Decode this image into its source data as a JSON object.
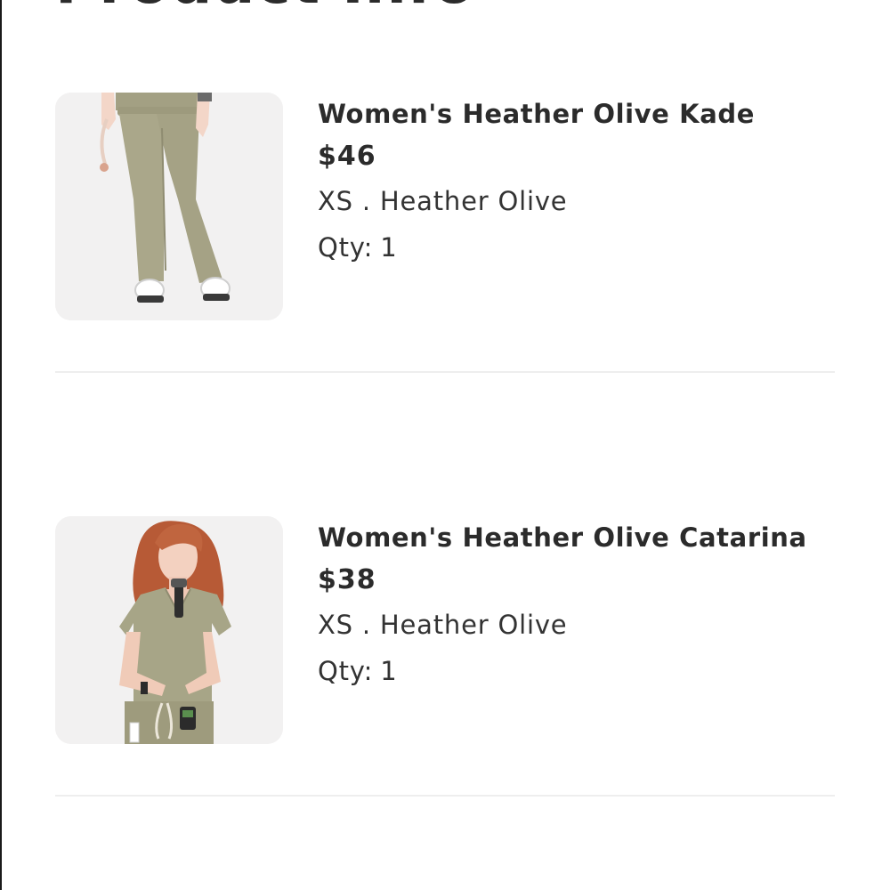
{
  "page": {
    "title": "Product Info"
  },
  "products": [
    {
      "name": "Women's Heather Olive Kade",
      "price": "$46",
      "variant": "XS . Heather Olive",
      "qty_label": "Qty:",
      "qty_value": "1",
      "image": "olive-scrub-pants-photo"
    },
    {
      "name": "Women's Heather Olive Catarina",
      "price": "$38",
      "variant": "XS . Heather Olive",
      "qty_label": "Qty:",
      "qty_value": "1",
      "image": "olive-scrub-top-photo"
    }
  ],
  "colors": {
    "text": "#2b2b2b",
    "thumb_bg": "#f2f1f1",
    "olive": "#a7a587",
    "divider": "#eeeeee"
  }
}
